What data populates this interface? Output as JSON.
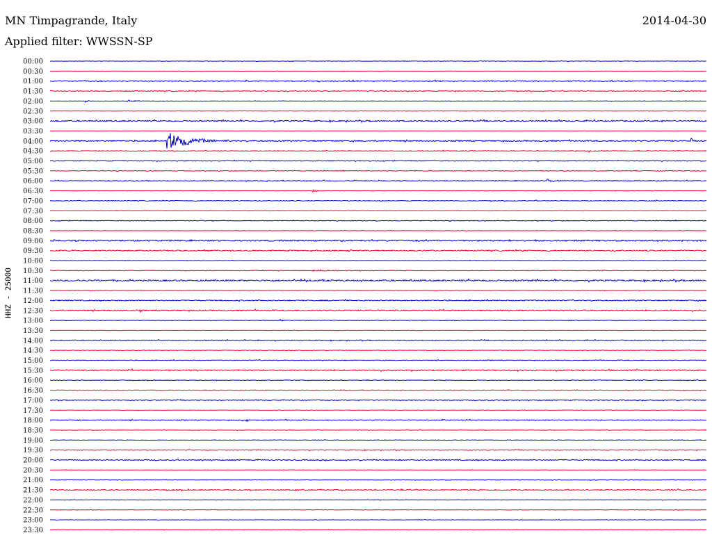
{
  "header": {
    "station": "MN Timpagrande, Italy",
    "date": "2014-04-30",
    "filter": "Applied filter: WWSSN-SP"
  },
  "axis": {
    "ylabel": "HHZ - 25000"
  },
  "colors": {
    "even_trace": "#0000cc",
    "odd_trace": "#ee0033",
    "background": "#ffffff",
    "text": "#000000"
  },
  "chart_data": {
    "type": "line",
    "title": "MN Timpagrande, Italy",
    "subtitle": "Applied filter: WWSSN-SP",
    "date": "2014-04-30",
    "ylabel": "HHZ - 25000",
    "xlabel": "",
    "minutes_per_line": 30,
    "rows": [
      {
        "label": "00:00",
        "noise": 0.3,
        "events": []
      },
      {
        "label": "00:30",
        "noise": 0.2,
        "events": []
      },
      {
        "label": "01:00",
        "noise": 0.7,
        "events": []
      },
      {
        "label": "01:30",
        "noise": 0.6,
        "events": []
      },
      {
        "label": "02:00",
        "noise": 0.3,
        "events": [
          {
            "minute": 1.6,
            "amp": 3,
            "dur": 0.4
          },
          {
            "minute": 3.5,
            "amp": 1.5,
            "dur": 1.5
          }
        ]
      },
      {
        "label": "02:30",
        "noise": 0.2,
        "events": []
      },
      {
        "label": "03:00",
        "noise": 0.9,
        "events": []
      },
      {
        "label": "03:30",
        "noise": 0.2,
        "events": []
      },
      {
        "label": "04:00",
        "noise": 0.8,
        "events": [
          {
            "minute": 5.3,
            "amp": 15,
            "dur": 2.8
          },
          {
            "minute": 29.3,
            "amp": 6,
            "dur": 0.15
          }
        ]
      },
      {
        "label": "04:30",
        "noise": 0.5,
        "events": [
          {
            "minute": 24.6,
            "amp": 3,
            "dur": 0.2
          }
        ]
      },
      {
        "label": "05:00",
        "noise": 0.5,
        "events": []
      },
      {
        "label": "05:30",
        "noise": 0.5,
        "events": []
      },
      {
        "label": "06:00",
        "noise": 0.6,
        "events": [
          {
            "minute": 22.7,
            "amp": 3,
            "dur": 0.9
          }
        ]
      },
      {
        "label": "06:30",
        "noise": 0.3,
        "events": [
          {
            "minute": 12.0,
            "amp": 2,
            "dur": 1.0
          }
        ]
      },
      {
        "label": "07:00",
        "noise": 0.5,
        "events": []
      },
      {
        "label": "07:30",
        "noise": 0.3,
        "events": []
      },
      {
        "label": "08:00",
        "noise": 0.5,
        "events": []
      },
      {
        "label": "08:30",
        "noise": 0.3,
        "events": []
      },
      {
        "label": "09:00",
        "noise": 0.9,
        "events": []
      },
      {
        "label": "09:30",
        "noise": 0.8,
        "events": []
      },
      {
        "label": "10:00",
        "noise": 0.3,
        "events": []
      },
      {
        "label": "10:30",
        "noise": 0.4,
        "events": [
          {
            "minute": 12.0,
            "amp": 1.5,
            "dur": 3.0
          }
        ]
      },
      {
        "label": "11:00",
        "noise": 1.0,
        "events": []
      },
      {
        "label": "11:30",
        "noise": 0.3,
        "events": []
      },
      {
        "label": "12:00",
        "noise": 0.7,
        "events": []
      },
      {
        "label": "12:30",
        "noise": 0.8,
        "events": [
          {
            "minute": 4.1,
            "amp": 3,
            "dur": 0.2
          }
        ]
      },
      {
        "label": "13:00",
        "noise": 0.3,
        "events": [
          {
            "minute": 10.5,
            "amp": 2,
            "dur": 0.4
          }
        ]
      },
      {
        "label": "13:30",
        "noise": 0.3,
        "events": []
      },
      {
        "label": "14:00",
        "noise": 0.6,
        "events": [
          {
            "minute": 9.5,
            "amp": 3,
            "dur": 0.3
          }
        ]
      },
      {
        "label": "14:30",
        "noise": 0.3,
        "events": []
      },
      {
        "label": "15:00",
        "noise": 0.5,
        "events": []
      },
      {
        "label": "15:30",
        "noise": 0.8,
        "events": []
      },
      {
        "label": "16:00",
        "noise": 0.4,
        "events": []
      },
      {
        "label": "16:30",
        "noise": 0.4,
        "events": []
      },
      {
        "label": "17:00",
        "noise": 0.5,
        "events": [
          {
            "minute": 20.7,
            "amp": 3,
            "dur": 0.2
          }
        ]
      },
      {
        "label": "17:30",
        "noise": 0.3,
        "events": []
      },
      {
        "label": "18:00",
        "noise": 0.6,
        "events": [
          {
            "minute": 8.8,
            "amp": 2,
            "dur": 0.8
          },
          {
            "minute": 17.9,
            "amp": 2,
            "dur": 0.4
          }
        ]
      },
      {
        "label": "18:30",
        "noise": 0.3,
        "events": []
      },
      {
        "label": "19:00",
        "noise": 0.3,
        "events": []
      },
      {
        "label": "19:30",
        "noise": 0.5,
        "events": []
      },
      {
        "label": "20:00",
        "noise": 0.7,
        "events": []
      },
      {
        "label": "20:30",
        "noise": 0.3,
        "events": []
      },
      {
        "label": "21:00",
        "noise": 0.3,
        "events": []
      },
      {
        "label": "21:30",
        "noise": 0.7,
        "events": []
      },
      {
        "label": "22:00",
        "noise": 0.3,
        "events": []
      },
      {
        "label": "22:30",
        "noise": 0.3,
        "events": []
      },
      {
        "label": "23:00",
        "noise": 0.3,
        "events": [
          {
            "minute": 17.1,
            "amp": 2,
            "dur": 0.2
          }
        ]
      },
      {
        "label": "23:30",
        "noise": 0.3,
        "events": []
      }
    ]
  }
}
